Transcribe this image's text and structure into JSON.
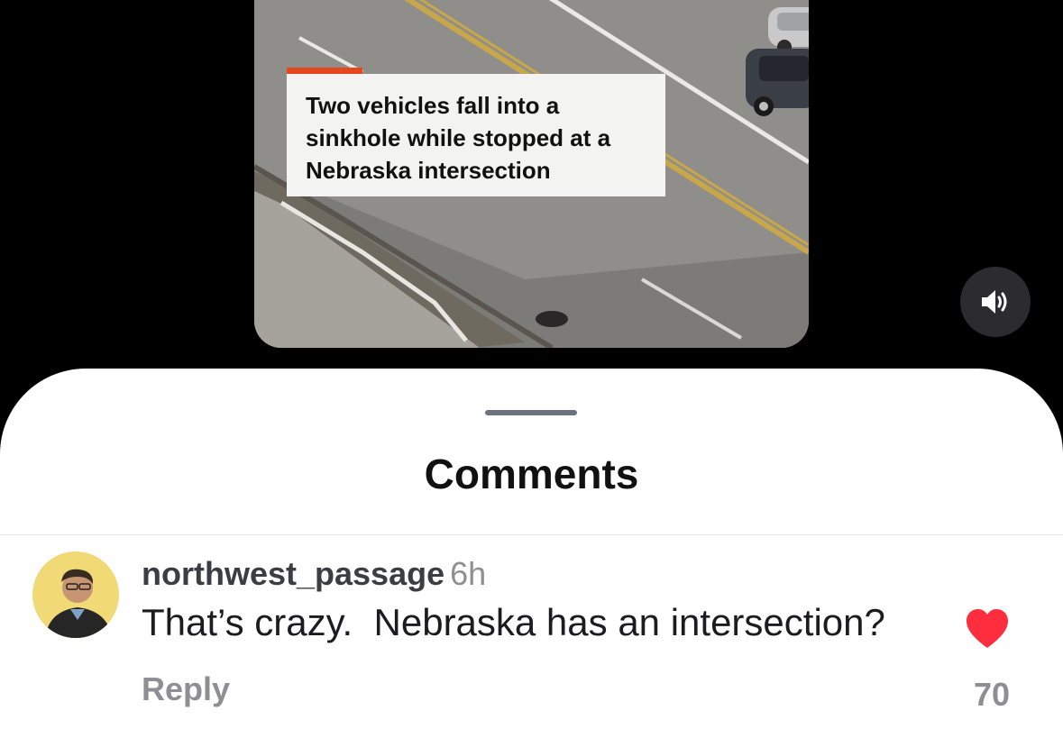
{
  "video": {
    "headline": "Two vehicles fall into a sinkhole while stopped at a Nebraska intersection",
    "accent_color": "#e5481e",
    "sound_icon": "speaker-volume-icon"
  },
  "comments_sheet": {
    "title": "Comments",
    "items": [
      {
        "username": "northwest_passage",
        "timestamp": "6h",
        "text": "That’s crazy.  Nebraska has an intersection?",
        "reply_label": "Reply",
        "like_icon": "heart-icon",
        "like_color": "#ff2d3d",
        "liked": true,
        "like_count": "70"
      }
    ]
  }
}
